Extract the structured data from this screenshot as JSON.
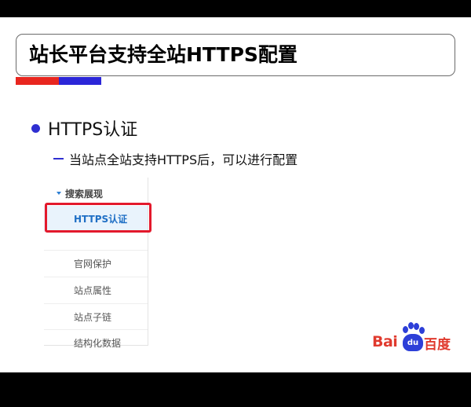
{
  "slide": {
    "title": "站长平台支持全站HTTPS配置",
    "bullet_main": "HTTPS认证",
    "bullet_sub": "当站点全站支持HTTPS后，可以进行配置"
  },
  "menu": {
    "section_header": "搜索展现",
    "items": [
      {
        "label": "HTTPS认证",
        "active": true
      },
      {
        "label": "官网保护"
      },
      {
        "label": "站点属性"
      },
      {
        "label": "站点子链"
      },
      {
        "label": "结构化数据"
      }
    ]
  },
  "logo": {
    "text_latin": "Bai",
    "paw_text": "du",
    "text_cn": "百度"
  },
  "colors": {
    "accent_red": "#e8261f",
    "accent_blue": "#2b26d8",
    "highlight_red": "#e3192c",
    "active_blue": "#1f6fc5"
  }
}
